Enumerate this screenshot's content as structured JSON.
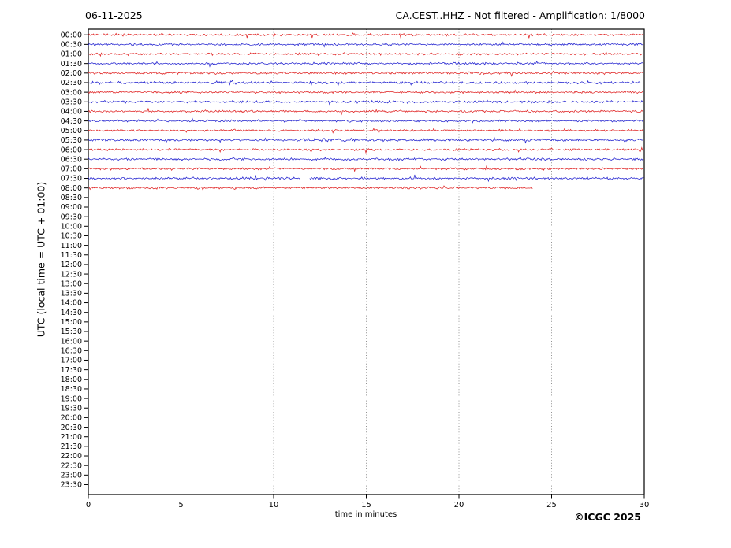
{
  "header": {
    "date": "06-11-2025",
    "station_title": "CA.CEST..HHZ - Not filtered - Amplification: 1/8000"
  },
  "footer": {
    "copyright": "©ICGC 2025"
  },
  "chart_data": {
    "type": "line",
    "subtype": "helicorder-seismogram",
    "title_left": "06-11-2025",
    "title_right": "CA.CEST..HHZ - Not filtered - Amplification: 1/8000",
    "xlabel": "time in minutes",
    "ylabel": "UTC (local time = UTC + 01:00)",
    "xlim": [
      0,
      30
    ],
    "x_ticks": [
      0,
      5,
      10,
      15,
      20,
      25,
      30
    ],
    "grid": "vertical-dotted-at-5-min",
    "grid_color": "#777777",
    "row_labels": [
      "00:00",
      "00:30",
      "01:00",
      "01:30",
      "02:00",
      "02:30",
      "03:00",
      "03:30",
      "04:00",
      "04:30",
      "05:00",
      "05:30",
      "06:00",
      "06:30",
      "07:00",
      "07:30",
      "08:00",
      "08:30",
      "09:00",
      "09:30",
      "10:00",
      "10:30",
      "11:00",
      "11:30",
      "12:00",
      "12:30",
      "13:00",
      "13:30",
      "14:00",
      "14:30",
      "15:00",
      "15:30",
      "16:00",
      "16:30",
      "17:00",
      "17:30",
      "18:00",
      "18:30",
      "19:00",
      "19:30",
      "20:00",
      "20:30",
      "21:00",
      "21:30",
      "22:00",
      "22:30",
      "23:00",
      "23:30"
    ],
    "trace_colors": {
      "red": "#dd1111",
      "blue": "#1111cc"
    },
    "traces": [
      {
        "row": "00:00",
        "color": "red",
        "start_min": 0,
        "end_min": 30,
        "amp": 1.0
      },
      {
        "row": "00:30",
        "color": "blue",
        "start_min": 0,
        "end_min": 30,
        "amp": 1.0
      },
      {
        "row": "01:00",
        "color": "red",
        "start_min": 0,
        "end_min": 30,
        "amp": 1.0
      },
      {
        "row": "01:30",
        "color": "blue",
        "start_min": 0,
        "end_min": 30,
        "amp": 1.0
      },
      {
        "row": "02:00",
        "color": "red",
        "start_min": 0,
        "end_min": 30,
        "amp": 1.1
      },
      {
        "row": "02:30",
        "color": "blue",
        "start_min": 0,
        "end_min": 30,
        "amp": 1.15,
        "bursts": [
          {
            "at": 7.4,
            "w": 1.2,
            "k": 1.8
          }
        ]
      },
      {
        "row": "03:00",
        "color": "red",
        "start_min": 0,
        "end_min": 30,
        "amp": 1.0
      },
      {
        "row": "03:30",
        "color": "blue",
        "start_min": 0,
        "end_min": 30,
        "amp": 1.1
      },
      {
        "row": "04:00",
        "color": "red",
        "start_min": 0,
        "end_min": 30,
        "amp": 1.0
      },
      {
        "row": "04:30",
        "color": "blue",
        "start_min": 0,
        "end_min": 30,
        "amp": 0.9
      },
      {
        "row": "05:00",
        "color": "red",
        "start_min": 0,
        "end_min": 30,
        "amp": 0.9
      },
      {
        "row": "05:30",
        "color": "blue",
        "start_min": 0,
        "end_min": 30,
        "amp": 1.1,
        "bursts": [
          {
            "at": 12.4,
            "w": 1.4,
            "k": 1.9
          }
        ]
      },
      {
        "row": "06:00",
        "color": "red",
        "start_min": 0,
        "end_min": 30,
        "amp": 1.0
      },
      {
        "row": "06:30",
        "color": "blue",
        "start_min": 0,
        "end_min": 30,
        "amp": 1.1
      },
      {
        "row": "07:00",
        "color": "red",
        "start_min": 0,
        "end_min": 30,
        "amp": 1.0
      },
      {
        "row": "07:30",
        "color": "blue",
        "start_min": 0,
        "end_min": 30,
        "amp": 1.1,
        "gaps": [
          [
            11.45,
            11.95
          ]
        ]
      },
      {
        "row": "08:00",
        "color": "red",
        "start_min": 0,
        "end_min": 24,
        "amp": 1.0
      }
    ]
  }
}
